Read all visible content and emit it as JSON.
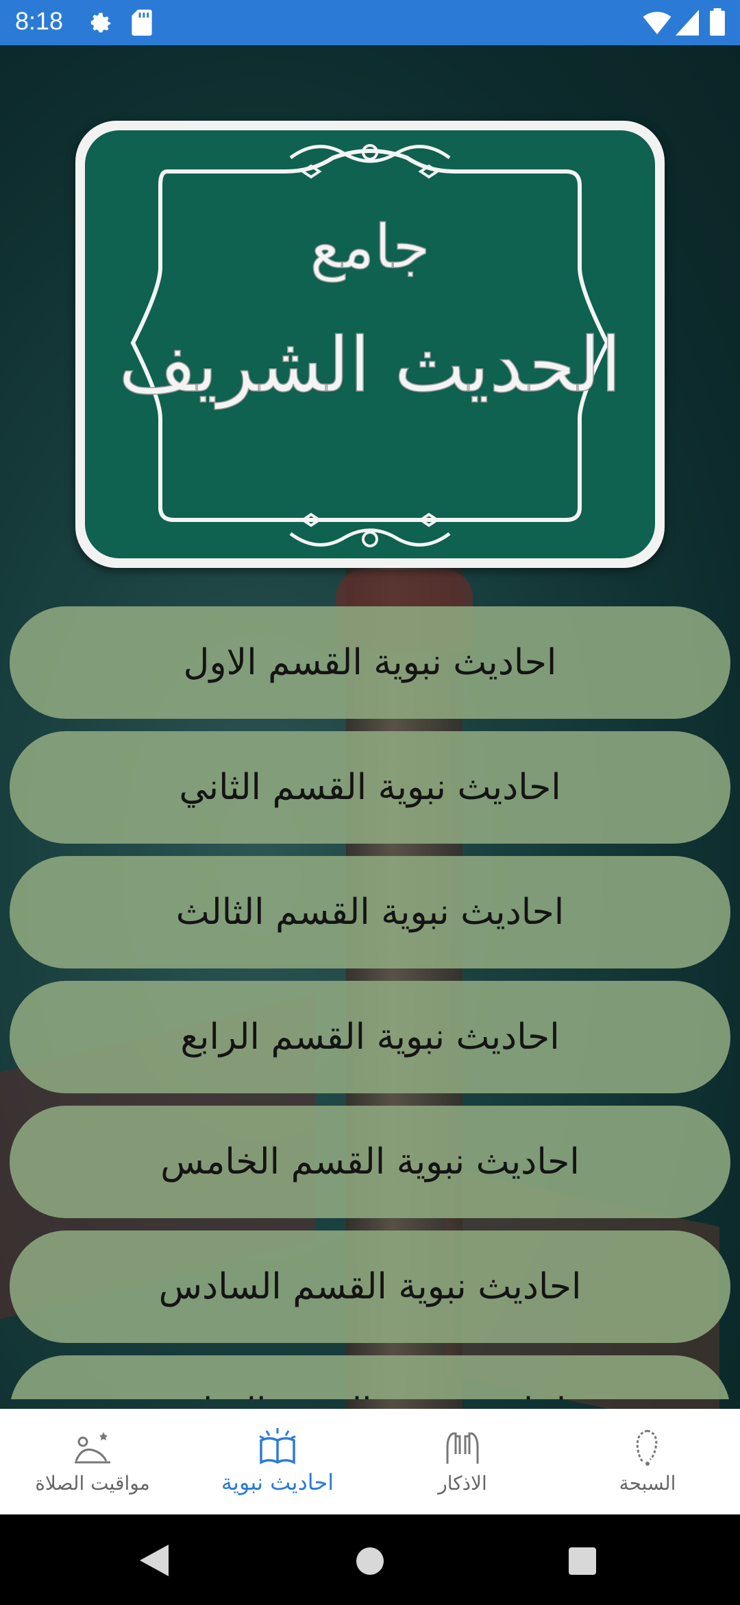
{
  "status_bar": {
    "time": "8:18",
    "background": "#2b7bd6"
  },
  "logo": {
    "line1": "جامع",
    "line2": "الحديث الشريف",
    "background": "#0f6150"
  },
  "menu": {
    "items": [
      {
        "label": "احاديث نبوية القسم الاول"
      },
      {
        "label": "احاديث نبوية القسم الثاني"
      },
      {
        "label": "احاديث نبوية القسم الثالث"
      },
      {
        "label": "احاديث نبوية القسم الرابع"
      },
      {
        "label": "احاديث نبوية القسم الخامس"
      },
      {
        "label": "احاديث نبوية القسم السادس"
      },
      {
        "label": "احاديث نبوية القسم السابع"
      }
    ],
    "button_color": "#8ea880"
  },
  "bottom_nav": {
    "items": [
      {
        "label": "مواقيت الصلاة",
        "icon": "praying-person-icon"
      },
      {
        "label": "احاديث نبوية",
        "icon": "open-book-icon",
        "active": true
      },
      {
        "label": "الاذكار",
        "icon": "praying-hands-icon"
      },
      {
        "label": "السبحة",
        "icon": "prayer-beads-icon"
      }
    ],
    "active_color": "#2b7bd6"
  }
}
